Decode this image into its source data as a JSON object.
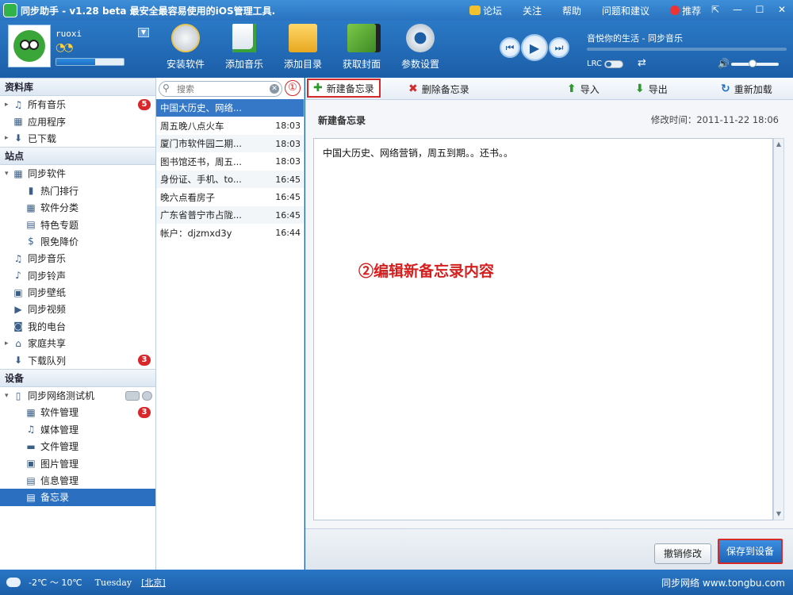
{
  "app": {
    "title": "同步助手 - v1.28 beta  最安全最容易使用的iOS管理工具.",
    "links": [
      "论坛",
      "关注",
      "帮助",
      "问题和建议",
      "推荐"
    ]
  },
  "user": {
    "name": "ruoxi",
    "capacity_fraction": 0.58
  },
  "toolbar": {
    "tools": [
      "安装软件",
      "添加音乐",
      "添加目录",
      "获取封面",
      "参数设置"
    ]
  },
  "player": {
    "song": "音悦你的生活 - 同步音乐",
    "lrc_label": "LRC"
  },
  "sidebar": {
    "library_title": "资料库",
    "library": [
      {
        "label": "所有音乐",
        "badge": "5"
      },
      {
        "label": "应用程序"
      },
      {
        "label": "已下载"
      }
    ],
    "sites_title": "站点",
    "sites": [
      {
        "label": "同步软件"
      },
      {
        "label": "热门排行"
      },
      {
        "label": "软件分类"
      },
      {
        "label": "特色专题"
      },
      {
        "label": "限免降价"
      },
      {
        "label": "同步音乐"
      },
      {
        "label": "同步铃声"
      },
      {
        "label": "同步壁纸"
      },
      {
        "label": "同步视频"
      },
      {
        "label": "我的电台"
      },
      {
        "label": "家庭共享"
      },
      {
        "label": "下载队列",
        "badge": "3"
      }
    ],
    "devices_title": "设备",
    "devices": [
      {
        "label": "同步网络测试机"
      },
      {
        "label": "软件管理",
        "badge": "3"
      },
      {
        "label": "媒体管理"
      },
      {
        "label": "文件管理"
      },
      {
        "label": "图片管理"
      },
      {
        "label": "信息管理"
      },
      {
        "label": "备忘录"
      }
    ]
  },
  "memo_list": {
    "search_placeholder": "搜索",
    "step_marker": "①",
    "items": [
      {
        "title": "中国大历史、网络...",
        "time": ""
      },
      {
        "title": "周五晚八点火车",
        "time": "18:03"
      },
      {
        "title": "厦门市软件园二期...",
        "time": "18:03"
      },
      {
        "title": "图书馆还书，周五...",
        "time": "18:03"
      },
      {
        "title": "身份证、手机、to...",
        "time": "16:45"
      },
      {
        "title": "晚六点看房子",
        "time": "16:45"
      },
      {
        "title": "广东省普宁市占陇...",
        "time": "16:45"
      },
      {
        "title": "帐户：djzmxd3y",
        "time": "16:44"
      }
    ]
  },
  "actions": {
    "new_memo": "新建备忘录",
    "delete_memo": "删除备忘录",
    "import": "导入",
    "export": "导出",
    "reload": "重新加载"
  },
  "editor": {
    "heading": "新建备忘录",
    "modified": "修改时间：2011-11-22 18:06",
    "content": "中国大历史、网络营销，周五到期。。还书。。",
    "annotation": "②编辑新备忘录内容"
  },
  "bottom": {
    "cancel": "撤销修改",
    "save": "保存到设备"
  },
  "status": {
    "weather": "-2℃ ～ 10℃",
    "weekday": "Tuesday",
    "city": "[北京]",
    "watermark": "同步网络 www.tongbu.com"
  }
}
